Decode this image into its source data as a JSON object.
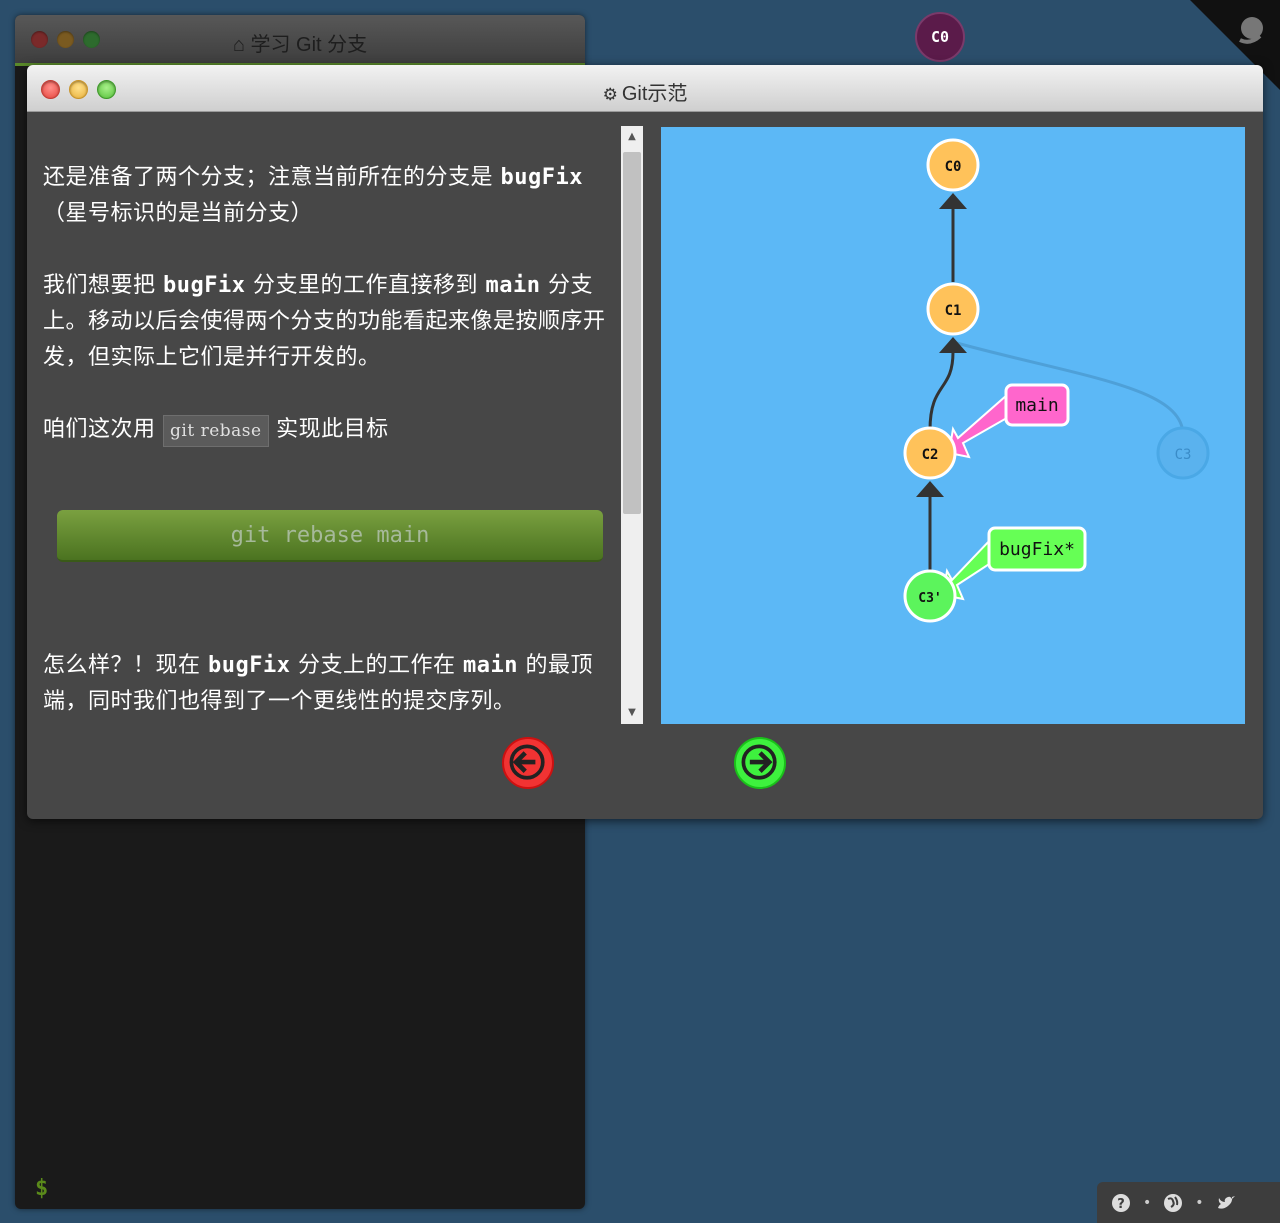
{
  "background_window": {
    "title": "学习 Git 分支",
    "prompt": "$"
  },
  "background_node": "C0",
  "dialog": {
    "title": "Git示范",
    "paragraphs": {
      "p1_text1": "还是准备了两个分支；注意当前所在的分支是",
      "p1_code1": "bugFix",
      "p1_text2": "（星号标识的是当前分支）",
      "p2_text1": "我们想要把",
      "p2_code1": "bugFix",
      "p2_text2": "分支里的工作直接移到",
      "p2_code2": "main",
      "p2_text3": "分支上。移动以后会使得两个分支的功能看起来像是按顺序开发，但实际上它们是并行开发的。",
      "p3_text1": "咱们这次用",
      "p3_chip": "git rebase",
      "p3_text2": "实现此目标",
      "p4_text1": "怎么样？！现在",
      "p4_code1": "bugFix",
      "p4_text2": "分支上的工作在",
      "p4_code2": "main",
      "p4_text3": "的最顶端，同时我们也得到了一个更线性的提交序列。"
    },
    "command_button": "git rebase main"
  },
  "graph": {
    "nodes": {
      "c0": "C0",
      "c1": "C1",
      "c2": "C2",
      "c3": "C3",
      "c3p": "C3'"
    },
    "branches": {
      "main": "main",
      "bugfix": "bugFix*"
    },
    "colors": {
      "node_orange": "#ffc25a",
      "node_green": "#5cf45c",
      "main_label": "#ff66cc",
      "bugfix_label": "#66ff55",
      "background": "#5cb8f6"
    }
  },
  "nav": {
    "back_icon": "arrow-left-icon",
    "forward_icon": "arrow-right-icon"
  },
  "widget": {
    "icons": [
      "help-icon",
      "globe-icon",
      "twitter-icon"
    ]
  }
}
